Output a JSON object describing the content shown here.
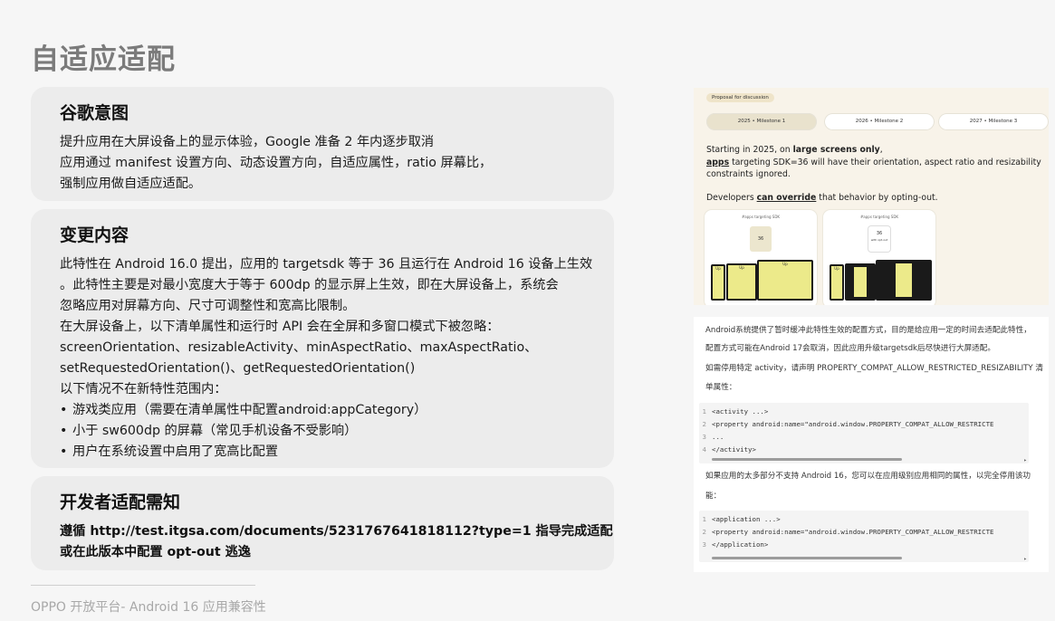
{
  "page_title": "自适应适配",
  "card1": {
    "title": "谷歌意图",
    "lines": [
      "提升应用在大屏设备上的显示体验，Google 准备 2 年内逐步取消",
      "应用通过 manifest 设置方向、动态设置方向，自适应属性，ratio 屏幕比，",
      "强制应用做自适应适配。"
    ]
  },
  "card2": {
    "title": "变更内容",
    "lines": [
      "此特性在 Android 16.0 提出，应用的 targetsdk 等于 36 且运行在 Android 16 设备上生效",
      "。此特性主要是对最小宽度大于等于 600dp 的显示屏上生效，即在大屏设备上，系统会",
      "忽略应用对屏幕方向、尺寸可调整性和宽高比限制。",
      "在大屏设备上，以下清单属性和运行时 API 会在全屏和多窗口模式下被忽略：",
      "screenOrientation、resizableActivity、minAspectRatio、maxAspectRatio、",
      "setRequestedOrientation()、getRequestedOrientation()",
      "以下情况不在新特性范围内："
    ],
    "bullets": [
      "游戏类应用（需要在清单属性中配置android:appCategory）",
      "小于 sw600dp 的屏幕（常见手机设备不受影响）",
      "用户在系统设置中启用了宽高比配置"
    ]
  },
  "card3": {
    "title": "开发者适配需知",
    "lines": [
      "遵循 http://test.itgsa.com/documents/5231767641818112?type=1 指导完成适配",
      "或在此版本中配置 opt-out 逃逸"
    ]
  },
  "footer": "OPPO 开放平台- Android 16 应用兼容性",
  "shot1": {
    "tag": "Proposal for discussion",
    "milestones": [
      "2025 • Milestone 1",
      "2026 • Milestone 2",
      "2027 • Milestone 3"
    ],
    "p1_a": "Starting in 2025, on ",
    "p1_bold": "large screens only",
    "p1_b": ",",
    "p1_link": "apps",
    "p1_c": " targeting SDK=36 will have their orientation, aspect ratio and resizability constraints ignored.",
    "p2_a": "Developers ",
    "p2_link": "can override",
    "p2_b": " that behavior by opting-out.",
    "left_label": "#apps targeting SDK",
    "left_value": "36",
    "right_label": "#apps targeting SDK",
    "right_value": "36",
    "right_sub": "with opt-out",
    "device_label": "Up"
  },
  "shot2": {
    "p1": "Android系统提供了暂时缓冲此特性生效的配置方式，目的是给应用一定的时间去适配此特性，",
    "p2": "配置方式可能在Android 17会取消，因此应用升级targetsdk后尽快进行大屏适配。",
    "p3": "如需停用特定 activity，请声明 PROPERTY_COMPAT_ALLOW_RESTRICTED_RESIZABILITY 清",
    "p4": "单属性：",
    "code1": [
      {
        "n": "1",
        "t": "<activity ...>"
      },
      {
        "n": "2",
        "t": "  <property android:name=\"android.window.PROPERTY_COMPAT_ALLOW_RESTRICTE"
      },
      {
        "n": "3",
        "t": "  ..."
      },
      {
        "n": "4",
        "t": "</activity>"
      }
    ],
    "p5": "如果应用的太多部分不支持 Android 16，您可以在应用级别应用相同的属性，以完全停用该功",
    "p6": "能：",
    "code2": [
      {
        "n": "1",
        "t": "<application ...>"
      },
      {
        "n": "2",
        "t": "  <property android:name=\"android.window.PROPERTY_COMPAT_ALLOW_RESTRICTE"
      },
      {
        "n": "3",
        "t": "</application>"
      }
    ]
  }
}
